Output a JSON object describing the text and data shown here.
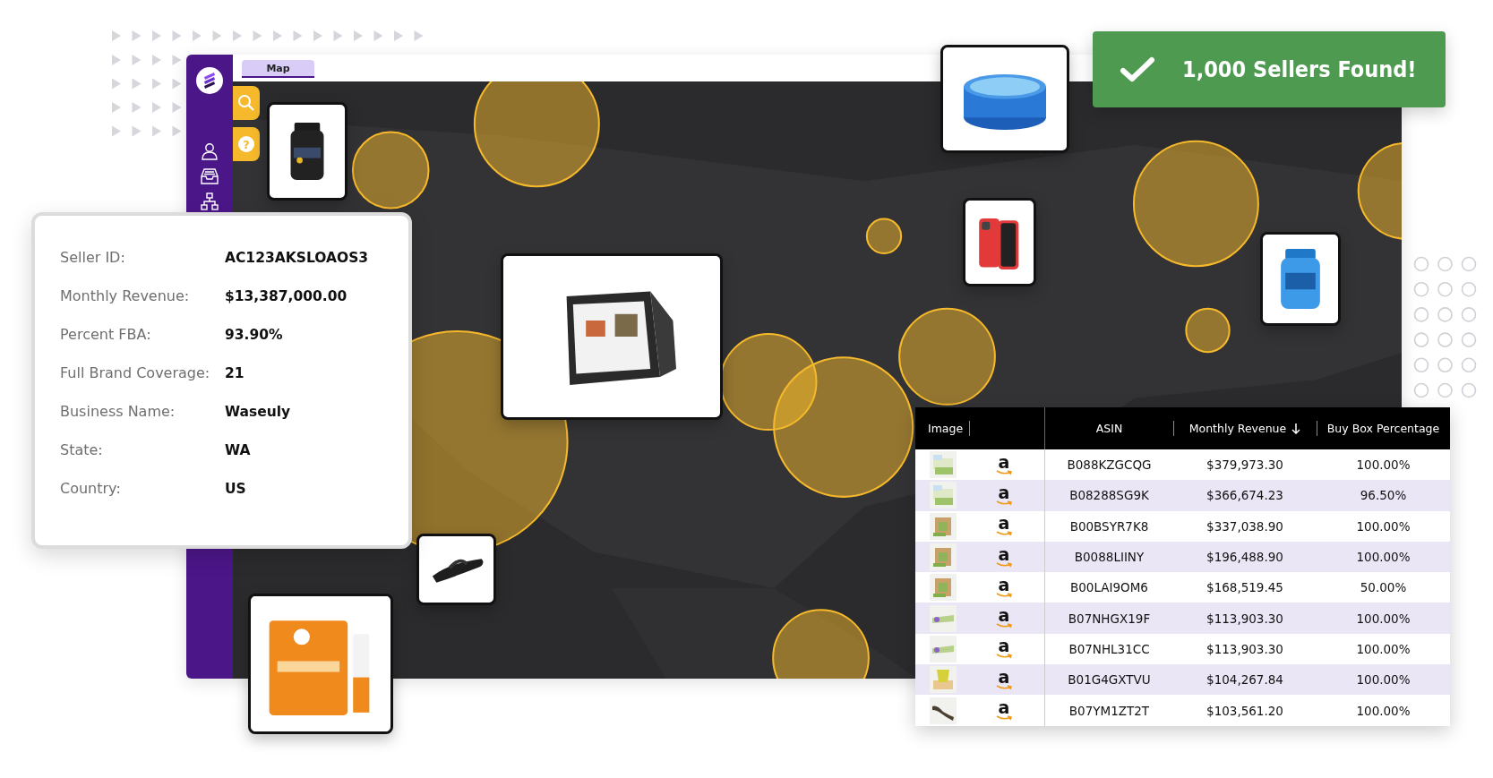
{
  "app": {
    "tabs": [
      {
        "label": "Map",
        "selected": true
      }
    ],
    "map_tools": [
      {
        "kind": "search"
      },
      {
        "kind": "help",
        "label": "?"
      }
    ]
  },
  "notification": {
    "text": "1,000 Sellers Found!"
  },
  "seller_details": [
    {
      "label": "Seller ID:",
      "value": "AC123AKSLOAOS3"
    },
    {
      "label": "Monthly Revenue:",
      "value": "$13,387,000.00"
    },
    {
      "label": "Percent FBA:",
      "value": "93.90%"
    },
    {
      "label": "Full Brand Coverage:",
      "value": "21"
    },
    {
      "label": "Business Name:",
      "value": "Waseuly"
    },
    {
      "label": "State:",
      "value": "WA"
    },
    {
      "label": "Country:",
      "value": "US"
    }
  ],
  "table": {
    "columns": [
      {
        "label": "Image",
        "sorted": false
      },
      {
        "label": "ASIN",
        "sorted": false
      },
      {
        "label": "Monthly Revenue",
        "sorted": true
      },
      {
        "label": "Buy Box Percentage",
        "sorted": false
      }
    ],
    "rows": [
      {
        "store": "a",
        "asin": "B088KZGCQG",
        "revenue": "$379,973.30",
        "buy_box": "100.00%"
      },
      {
        "store": "a",
        "asin": "B08288SG9K",
        "revenue": "$366,674.23",
        "buy_box": "96.50%"
      },
      {
        "store": "a",
        "asin": "B00BSYR7K8",
        "revenue": "$337,038.90",
        "buy_box": "100.00%"
      },
      {
        "store": "a",
        "asin": "B0088LIINY",
        "revenue": "$196,488.90",
        "buy_box": "100.00%"
      },
      {
        "store": "a",
        "asin": "B00LAI9OM6",
        "revenue": "$168,519.45",
        "buy_box": "50.00%"
      },
      {
        "store": "a",
        "asin": "B07NHGX19F",
        "revenue": "$113,903.30",
        "buy_box": "100.00%"
      },
      {
        "store": "a",
        "asin": "B07NHL31CC",
        "revenue": "$113,903.30",
        "buy_box": "100.00%"
      },
      {
        "store": "a",
        "asin": "B01G4GXTVU",
        "revenue": "$104,267.84",
        "buy_box": "100.00%"
      },
      {
        "store": "a",
        "asin": "B07YM1ZT2T",
        "revenue": "$103,561.20",
        "buy_box": "100.00%"
      }
    ]
  }
}
